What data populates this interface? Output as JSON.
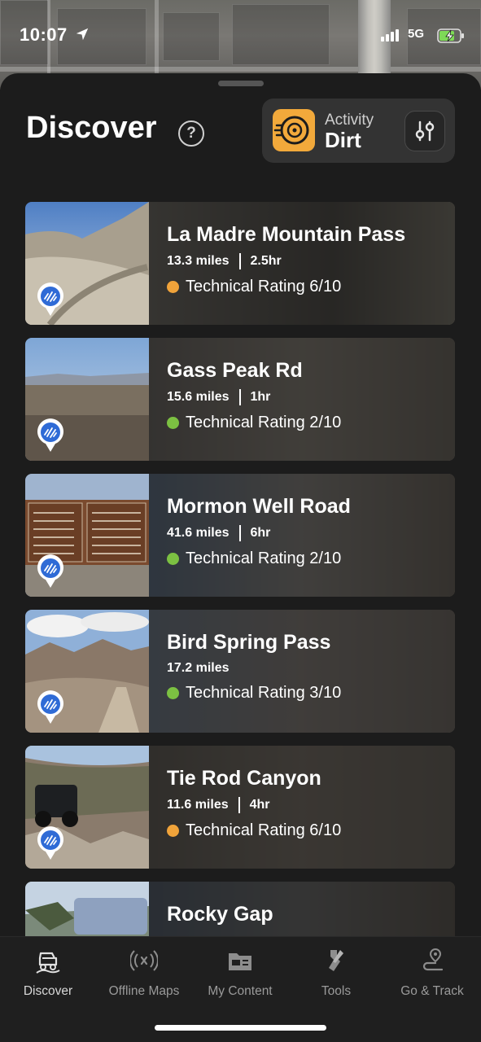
{
  "status_bar": {
    "time": "10:07",
    "network": "5G",
    "location_icon": "location-arrow-icon",
    "battery_icon": "battery-charging-icon"
  },
  "header": {
    "title": "Discover",
    "help_icon": "question-circle-icon",
    "help_glyph": "?",
    "activity": {
      "label": "Activity",
      "value": "Dirt",
      "icon": "tire-icon",
      "accent_color": "#f2a93b"
    },
    "filter_icon": "sliders-icon"
  },
  "trails": [
    {
      "name": "La Madre Mountain Pass",
      "distance": "13.3 miles",
      "duration": "2.5hr",
      "rating_label": "Technical Rating 6/10",
      "rating_color": "#f0a33a"
    },
    {
      "name": "Gass Peak Rd",
      "distance": "15.6 miles",
      "duration": "1hr",
      "rating_label": "Technical Rating 2/10",
      "rating_color": "#7cc142"
    },
    {
      "name": "Mormon Well Road",
      "distance": "41.6 miles",
      "duration": "6hr",
      "rating_label": "Technical Rating 2/10",
      "rating_color": "#7cc142"
    },
    {
      "name": "Bird Spring Pass",
      "distance": "17.2 miles",
      "duration": "",
      "rating_label": "Technical Rating 3/10",
      "rating_color": "#7cc142"
    },
    {
      "name": "Tie Rod Canyon",
      "distance": "11.6 miles",
      "duration": "4hr",
      "rating_label": "Technical Rating 6/10",
      "rating_color": "#f0a33a"
    },
    {
      "name": "Rocky Gap",
      "distance": "",
      "duration": "",
      "rating_label": "",
      "rating_color": ""
    }
  ],
  "tabs": [
    {
      "label": "Discover",
      "icon": "jeep-icon",
      "active": true
    },
    {
      "label": "Offline Maps",
      "icon": "broadcast-icon",
      "active": false
    },
    {
      "label": "My Content",
      "icon": "folder-icon",
      "active": false
    },
    {
      "label": "Tools",
      "icon": "tools-icon",
      "active": false
    },
    {
      "label": "Go & Track",
      "icon": "route-pin-icon",
      "active": false
    }
  ]
}
